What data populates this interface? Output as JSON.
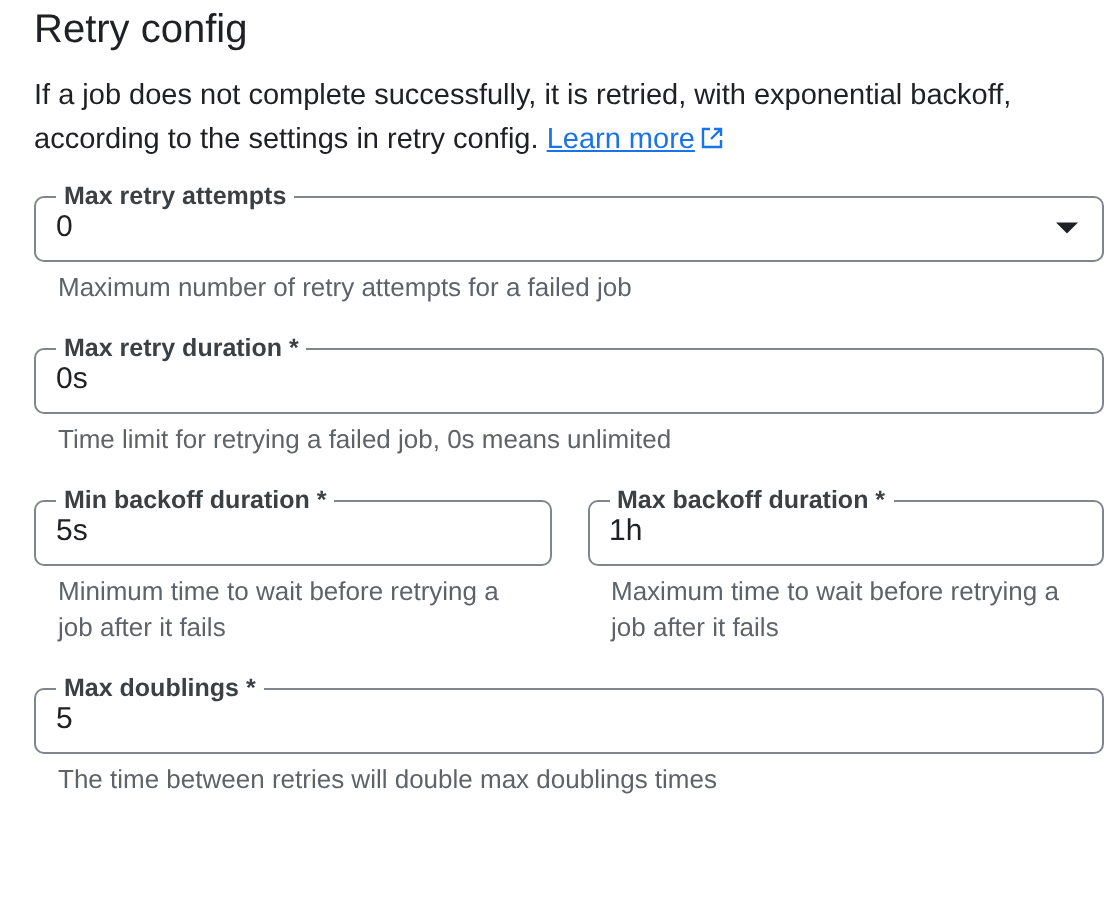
{
  "title": "Retry config",
  "description": "If a job does not complete successfully, it is retried, with exponential backoff, according to the settings in retry config.",
  "learn_more": "Learn more",
  "rows": [
    {
      "fields": [
        {
          "kind": "select",
          "label": "Max retry attempts",
          "value": "0",
          "hint": "Maximum number of retry attempts for a failed job"
        }
      ]
    },
    {
      "fields": [
        {
          "kind": "text",
          "label": "Max retry duration *",
          "value": "0s",
          "hint": "Time limit for retrying a failed job, 0s means unlimited"
        }
      ]
    },
    {
      "fields": [
        {
          "kind": "text",
          "label": "Min backoff duration *",
          "value": "5s",
          "hint": "Minimum time to wait before retrying a job after it fails"
        },
        {
          "kind": "text",
          "label": "Max backoff duration *",
          "value": "1h",
          "hint": "Maximum time to wait before retrying a job after it fails"
        }
      ]
    },
    {
      "fields": [
        {
          "kind": "text",
          "label": "Max doublings *",
          "value": "5",
          "hint": "The time between retries will double max doublings times"
        }
      ]
    }
  ]
}
